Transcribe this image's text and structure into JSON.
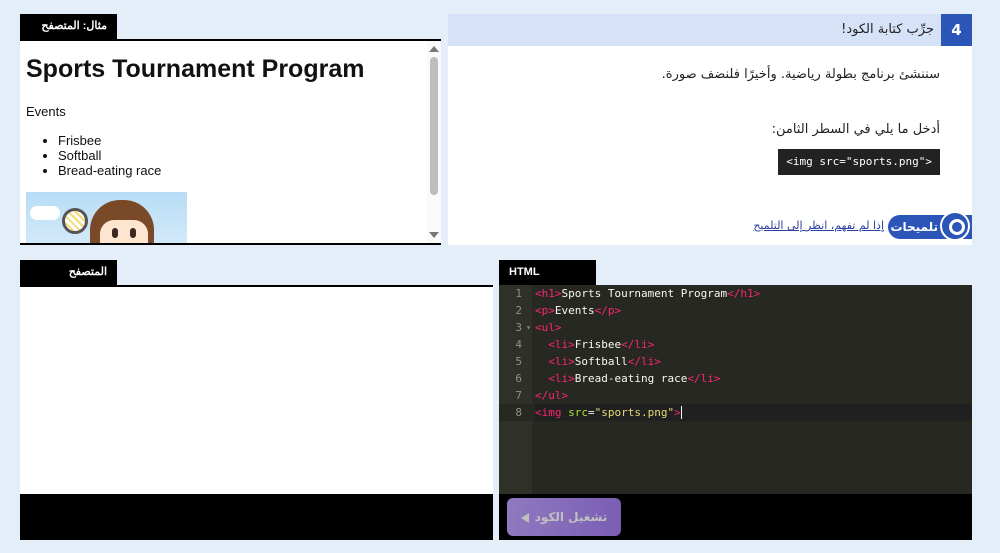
{
  "example": {
    "tab_label": "مثال: المتصفح",
    "page": {
      "heading": "Sports Tournament Program",
      "paragraph": "Events",
      "items": [
        "Frisbee",
        "Softball",
        "Bread-eating race"
      ]
    }
  },
  "instruction": {
    "step_number": "4",
    "title": "جرِّب كتابة الكود!",
    "text_1": "سننشئ برنامج بطولة رياضية. وأخيرًا فلنضف صورة.",
    "text_2": "أدخل ما يلي في السطر الثامن:",
    "code_sample": "<img src=\"sports.png\">",
    "hint_label": "تلميحات",
    "hint_link": "إذا لم تفهم، انظر إلى التلميح"
  },
  "result": {
    "tab_label": "المتصفح"
  },
  "editor": {
    "tab_label": "HTML",
    "line_numbers": [
      "1",
      "2",
      "3",
      "4",
      "5",
      "6",
      "7",
      "8"
    ],
    "fold_marker": "▾",
    "lines": [
      {
        "indent": "",
        "open": "<h1>",
        "text": "Sports Tournament Program",
        "close": "</h1>"
      },
      {
        "indent": "",
        "open": "<p>",
        "text": "Events",
        "close": "</p>"
      },
      {
        "indent": "",
        "open": "<ul>",
        "text": "",
        "close": ""
      },
      {
        "indent": "  ",
        "open": "<li>",
        "text": "Frisbee",
        "close": "</li>"
      },
      {
        "indent": "  ",
        "open": "<li>",
        "text": "Softball",
        "close": "</li>"
      },
      {
        "indent": "  ",
        "open": "<li>",
        "text": "Bread-eating race",
        "close": "</li>"
      },
      {
        "indent": "",
        "open": "</ul>",
        "text": "",
        "close": ""
      }
    ],
    "line8": {
      "tag_open": "<img ",
      "attr": "src",
      "eq": "=",
      "value": "\"sports.png\"",
      "tag_close": ">"
    },
    "run_label": "تشغيل الكود"
  },
  "colors": {
    "accent": "#2c55b8",
    "run_button": "#a27df0",
    "editor_bg": "#272822"
  }
}
